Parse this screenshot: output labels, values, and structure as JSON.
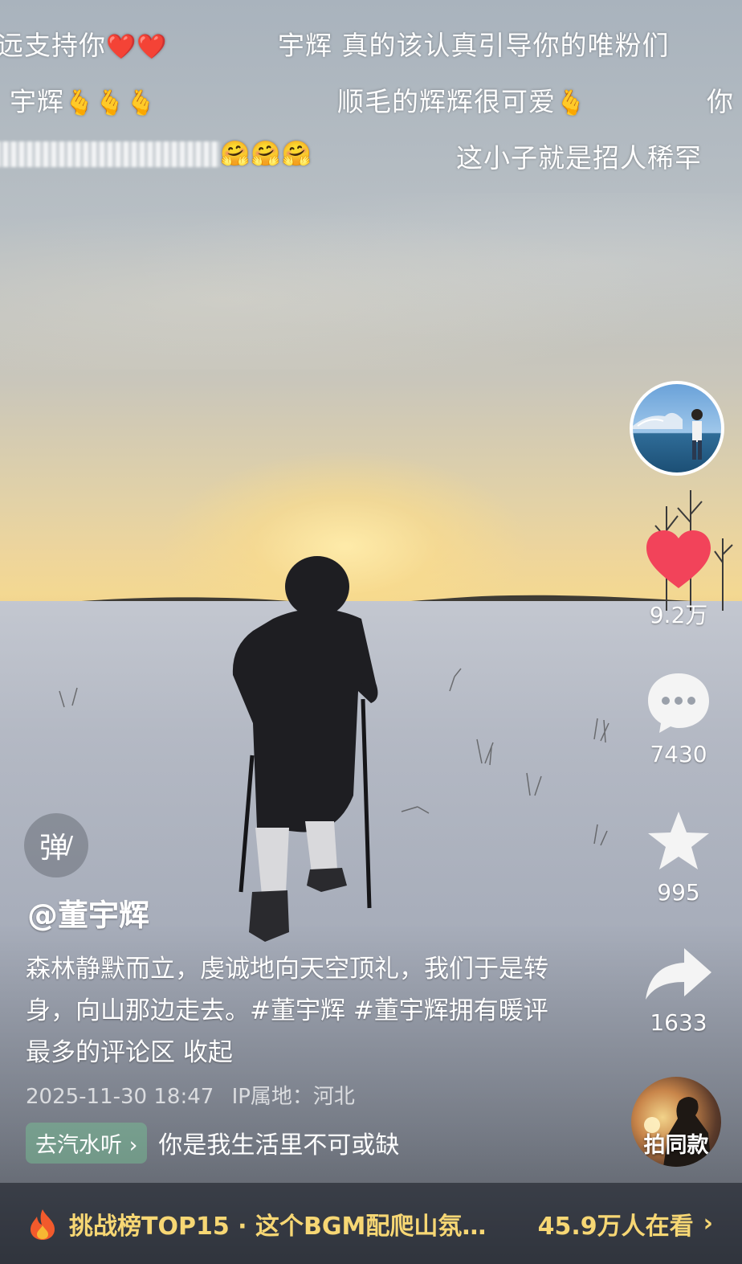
{
  "danmu": {
    "row1_left": "远支持你",
    "row1_right": "宇辉 真的该认真引导你的唯粉们",
    "row2_left": "宇辉",
    "row2_middle": "顺毛的辉辉很可爱",
    "row2_right": "你",
    "row3_right": "这小子就是招人稀罕"
  },
  "actions": {
    "like_count": "9.2万",
    "comment_count": "7430",
    "favorite_count": "995",
    "share_count": "1633"
  },
  "danmu_toggle": "弹",
  "post": {
    "author": "@董宇辉",
    "description": "森林静默而立，虔诚地向天空顶礼，我们于是转身，向山那边走去。#董宇辉 #董宇辉拥有暖评最多的评论区 收起",
    "timestamp": "2025-11-30 18:47",
    "ip_location": "IP属地：河北"
  },
  "music": {
    "pill": "去汽水听",
    "chevron": "›",
    "text": "你是我生活里不可或缺"
  },
  "same_style": "拍同款",
  "bottom_bar": {
    "rank_text": "挑战榜TOP15 · 这个BGM配爬山氛…",
    "viewers": "45.9万人在看",
    "chevron": "›"
  },
  "colors": {
    "like_red": "#f2435a",
    "highlight_yellow": "#f7d774"
  }
}
